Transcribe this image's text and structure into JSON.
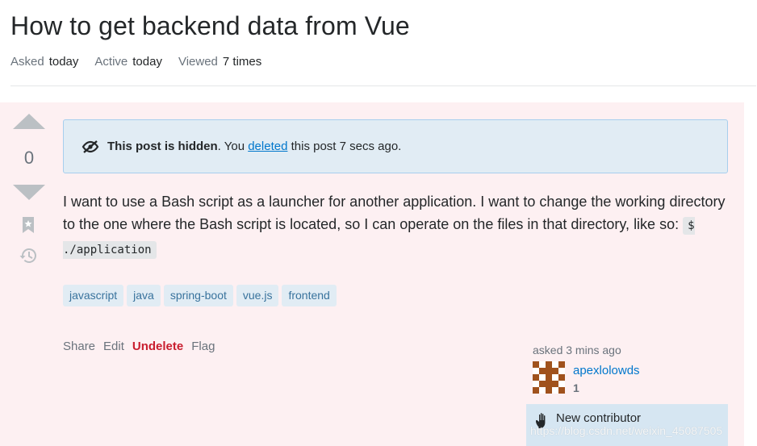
{
  "question": {
    "title": "How to get backend data from Vue",
    "meta": [
      {
        "key": "Asked",
        "value": "today"
      },
      {
        "key": "Active",
        "value": "today"
      },
      {
        "key": "Viewed",
        "value": "7 times"
      }
    ]
  },
  "vote": {
    "count": "0"
  },
  "notice": {
    "bold": "This post is hidden",
    "pre": ". You ",
    "link": "deleted",
    "post": " this post 7 secs ago."
  },
  "body": {
    "text": "I want to use a Bash script as a launcher for another application. I want to change the working directory to the one where the Bash script is located, so I can operate on the files in that directory, like so: ",
    "code": "$ ./application"
  },
  "tags": [
    "javascript",
    "java",
    "spring-boot",
    "vue.js",
    "frontend"
  ],
  "post_menu": {
    "share": "Share",
    "edit": "Edit",
    "undelete": "Undelete",
    "flag": "Flag"
  },
  "user_card": {
    "asked": "asked 3 mins ago",
    "name": "apexlolowds",
    "reputation": "1",
    "new_contributor": "New contributor"
  },
  "watermark": "https://blog.csdn.net/weixin_45087505",
  "colors": {
    "deleted_bg": "#fdf0f2",
    "notice_bg": "#e1ecf4",
    "tag_bg": "#e1ecf4",
    "tag_text": "#39739d",
    "link": "#0077cc",
    "undelete": "#c91d2e"
  }
}
